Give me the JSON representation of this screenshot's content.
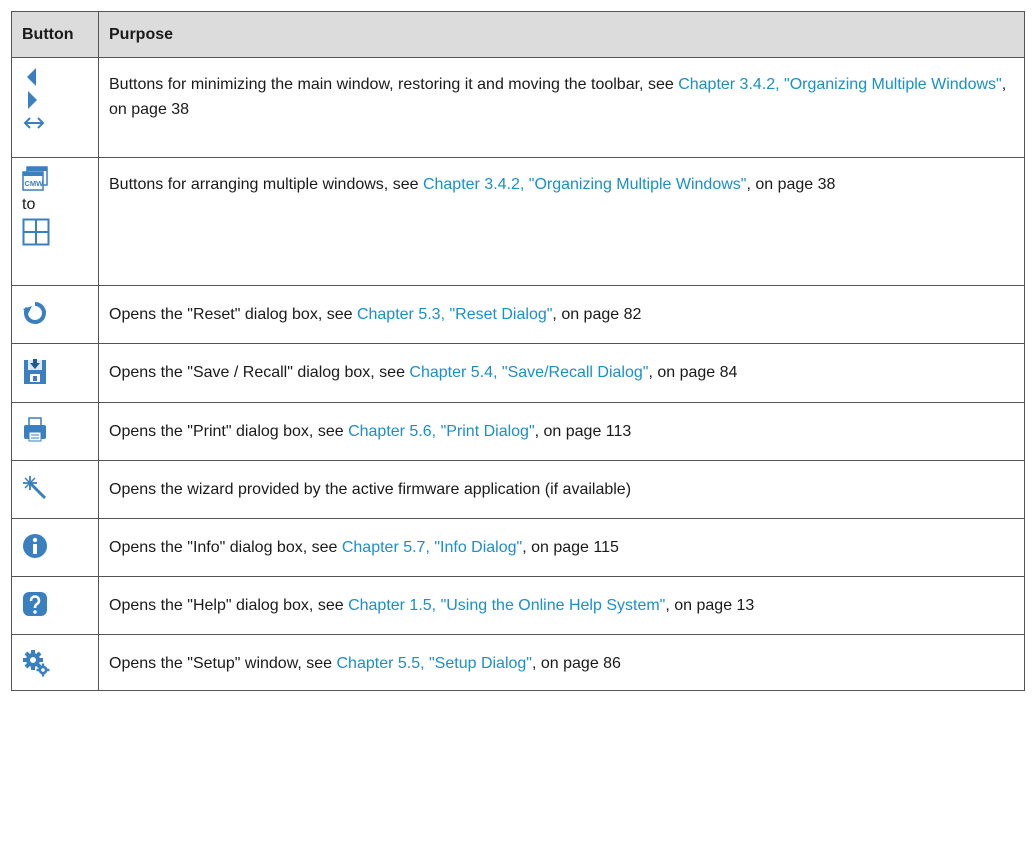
{
  "header": {
    "button": "Button",
    "purpose": "Purpose"
  },
  "colors": {
    "link": "#1a8fc8",
    "icon_blue": "#3a7fc0"
  },
  "rows": [
    {
      "icons": [
        "arrow-left-icon",
        "arrow-right-icon",
        "double-arrow-icon"
      ],
      "pre": "Buttons for minimizing the main window, restoring it and moving the toolbar, see ",
      "link": "Chapter 3.4.2, \"Organizing Multiple Windows\"",
      "post": ", on page 38"
    },
    {
      "icons": [
        "cmw-window-icon",
        "grid-four-icon"
      ],
      "to_label": "to",
      "pre": "Buttons for arranging multiple windows, see ",
      "link": "Chapter 3.4.2, \"Organizing Multiple Windows\"",
      "post": ", on page 38"
    },
    {
      "icons": [
        "reset-icon"
      ],
      "pre": "Opens the \"Reset\" dialog box, see ",
      "link": "Chapter 5.3, \"Reset Dialog\"",
      "post": ", on page 82"
    },
    {
      "icons": [
        "save-recall-icon"
      ],
      "pre": "Opens the \"Save / Recall\" dialog box, see ",
      "link": "Chapter 5.4, \"Save/Recall Dialog\"",
      "post": ", on page 84"
    },
    {
      "icons": [
        "printer-icon"
      ],
      "pre": "Opens the \"Print\" dialog box, see ",
      "link": "Chapter 5.6, \"Print Dialog\"",
      "post": ", on page 113"
    },
    {
      "icons": [
        "wizard-icon"
      ],
      "pre": "Opens the wizard provided by the active firmware application (if available)",
      "link": "",
      "post": ""
    },
    {
      "icons": [
        "info-icon"
      ],
      "pre": "Opens the \"Info\" dialog box, see ",
      "link": "Chapter 5.7, \"Info Dialog\"",
      "post": ", on page 115"
    },
    {
      "icons": [
        "help-icon"
      ],
      "pre": "Opens the \"Help\" dialog box, see ",
      "link": "Chapter 1.5, \"Using the Online Help System\"",
      "post": ", on page 13"
    },
    {
      "icons": [
        "setup-gears-icon"
      ],
      "pre": "Opens the \"Setup\" window, see ",
      "link": "Chapter 5.5, \"Setup Dialog\"",
      "post": ", on page 86"
    }
  ]
}
